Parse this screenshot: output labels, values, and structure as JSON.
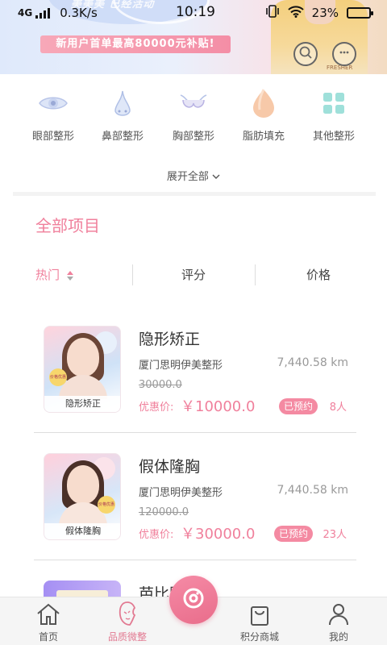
{
  "status_bar": {
    "network": "4G",
    "speed": "0.3K/s",
    "time": "10:19",
    "battery": "23%",
    "battery_level": 0.23
  },
  "banner": {
    "promo_text": "美美美 已经活动",
    "subsidy_text": "新用户首单最高80000元补贴!",
    "model_label": "FRESHER",
    "colors": {
      "accent": "#f48ea6"
    }
  },
  "categories": [
    {
      "label": "眼部整形",
      "icon": "eye-icon"
    },
    {
      "label": "鼻部整形",
      "icon": "nose-icon"
    },
    {
      "label": "胸部整形",
      "icon": "chest-icon"
    },
    {
      "label": "脂肪填充",
      "icon": "fat-drop-icon"
    },
    {
      "label": "其他整形",
      "icon": "grid-icon"
    }
  ],
  "expand_all": "展开全部",
  "section_title": "全部项目",
  "tabs": {
    "hot": "热门",
    "rating": "评分",
    "price": "价格"
  },
  "items": [
    {
      "name": "隐形矫正",
      "clinic": "厦门思明伊美整形",
      "distance": "7,440.58 km",
      "original_price": "30000.0",
      "price_label": "优惠价:",
      "price": "￥10000.0",
      "badge": "已预约",
      "count": "8人",
      "thumb_tag": "隐形矫正",
      "thumb_chip": "价格优惠"
    },
    {
      "name": "假体隆胸",
      "clinic": "厦门思明伊美整形",
      "distance": "7,440.58 km",
      "original_price": "120000.0",
      "price_label": "优惠价:",
      "price": "￥30000.0",
      "badge": "已预约",
      "count": "23人",
      "thumb_tag": "假体隆胸",
      "thumb_chip": "价格优惠"
    },
    {
      "name": "芭比脚"
    }
  ],
  "bottom_nav": {
    "home": "首页",
    "quality": "品质微整",
    "mall": "积分商城",
    "mine": "我的"
  },
  "colors": {
    "pink": "#f0809c",
    "badge": "#f48aa2"
  }
}
